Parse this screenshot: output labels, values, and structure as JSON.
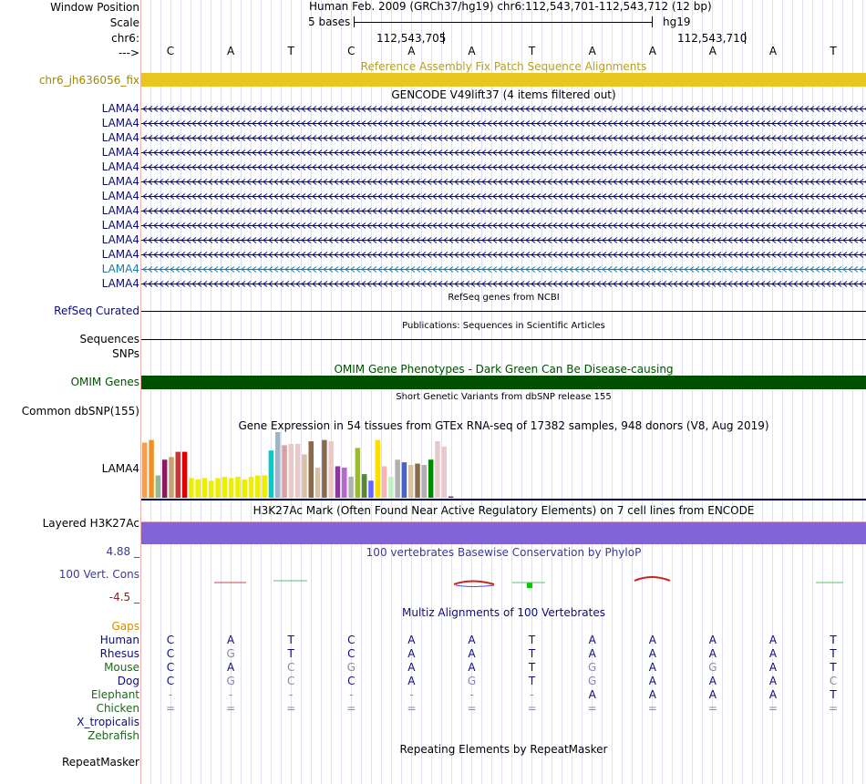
{
  "header": {
    "window_position_label": "Window Position",
    "scale_label": "Scale",
    "chr_label": "chr6:",
    "strand_label": "--->",
    "assembly_text": "Human Feb. 2009 (GRCh37/hg19)   chr6:112,543,701-112,543,712 (12 bp)",
    "scale_text": "5 bases",
    "db_text": "hg19",
    "pos1": "112,543,705",
    "pos2": "112,543,710"
  },
  "bases": [
    "C",
    "A",
    "T",
    "C",
    "A",
    "A",
    "T",
    "A",
    "A",
    "A",
    "A",
    "T"
  ],
  "fix_patch": {
    "label": "chr6_jh636056_fix",
    "title": "Reference Assembly Fix Patch Sequence Alignments",
    "color": "#e8c820"
  },
  "gencode": {
    "title": "GENCODE V49lift37 (4 items filtered out)",
    "genes": [
      "LAMA4",
      "LAMA4",
      "LAMA4",
      "LAMA4",
      "LAMA4",
      "LAMA4",
      "LAMA4",
      "LAMA4",
      "LAMA4",
      "LAMA4",
      "LAMA4",
      "LAMA4",
      "LAMA4"
    ],
    "colors": [
      "#0c0c78",
      "#0c0c78",
      "#0c0c78",
      "#0c0c78",
      "#0c0c78",
      "#0c0c78",
      "#0c0c78",
      "#0c0c78",
      "#0c0c78",
      "#0c0c78",
      "#0c0c78",
      "#1a7aa8",
      "#0c0c78"
    ]
  },
  "refseq": {
    "title": "RefSeq genes from NCBI",
    "label": "RefSeq Curated"
  },
  "publications": {
    "title": "Publications: Sequences in Scientific Articles",
    "label": "Sequences"
  },
  "snps_label": "SNPs",
  "omim": {
    "title": "OMIM Gene Phenotypes - Dark Green Can Be Disease-causing",
    "label": "OMIM Genes",
    "color": "#005000"
  },
  "dbsnp": {
    "title": "Short Genetic Variants from dbSNP release 155",
    "label": "Common dbSNP(155)"
  },
  "gtex": {
    "title": "Gene Expression in 54 tissues from GTEx RNA-seq of 17382 samples, 948 donors (V8, Aug 2019)",
    "label": "LAMA4",
    "bars": [
      {
        "v": 0.84,
        "c": "#f0a050"
      },
      {
        "v": 0.88,
        "c": "#f09020"
      },
      {
        "v": 0.34,
        "c": "#8fbc8f"
      },
      {
        "v": 0.58,
        "c": "#8b1a5a"
      },
      {
        "v": 0.62,
        "c": "#c8a070"
      },
      {
        "v": 0.7,
        "c": "#cc3333"
      },
      {
        "v": 0.7,
        "c": "#dd0000"
      },
      {
        "v": 0.3,
        "c": "#eeee00"
      },
      {
        "v": 0.28,
        "c": "#eeee00"
      },
      {
        "v": 0.3,
        "c": "#eeee00"
      },
      {
        "v": 0.26,
        "c": "#eeee00"
      },
      {
        "v": 0.3,
        "c": "#eeee00"
      },
      {
        "v": 0.32,
        "c": "#eeee00"
      },
      {
        "v": 0.3,
        "c": "#eeee00"
      },
      {
        "v": 0.32,
        "c": "#eeee00"
      },
      {
        "v": 0.28,
        "c": "#eeee00"
      },
      {
        "v": 0.32,
        "c": "#eeee00"
      },
      {
        "v": 0.34,
        "c": "#eeee00"
      },
      {
        "v": 0.34,
        "c": "#eeee00"
      },
      {
        "v": 0.72,
        "c": "#00cccc"
      },
      {
        "v": 1.0,
        "c": "#a0b4c8"
      },
      {
        "v": 0.8,
        "c": "#dba0a0"
      },
      {
        "v": 0.82,
        "c": "#e8c8c8"
      },
      {
        "v": 0.82,
        "c": "#e8c8c8"
      },
      {
        "v": 0.66,
        "c": "#d8c0a0"
      },
      {
        "v": 0.86,
        "c": "#8b6a4a"
      },
      {
        "v": 0.46,
        "c": "#d8c0a0"
      },
      {
        "v": 0.88,
        "c": "#8b6a4a"
      },
      {
        "v": 0.86,
        "c": "#e8c8c8"
      },
      {
        "v": 0.48,
        "c": "#8b3a9a"
      },
      {
        "v": 0.46,
        "c": "#bb66cc"
      },
      {
        "v": 0.32,
        "c": "#b0b0b0"
      },
      {
        "v": 0.76,
        "c": "#99bb33"
      },
      {
        "v": 0.36,
        "c": "#558b2f"
      },
      {
        "v": 0.26,
        "c": "#6666ff"
      },
      {
        "v": 0.88,
        "c": "#ffdd00"
      },
      {
        "v": 0.48,
        "c": "#ffb0b0"
      },
      {
        "v": 0.32,
        "c": "#c0f0c0"
      },
      {
        "v": 0.58,
        "c": "#b0b0b0"
      },
      {
        "v": 0.54,
        "c": "#4466cc"
      },
      {
        "v": 0.5,
        "c": "#d8c0a0"
      },
      {
        "v": 0.52,
        "c": "#8b6a4a"
      },
      {
        "v": 0.5,
        "c": "#b0b0b0"
      },
      {
        "v": 0.58,
        "c": "#008800"
      },
      {
        "v": 0.86,
        "c": "#e8c8c8"
      },
      {
        "v": 0.78,
        "c": "#e8c8c8"
      },
      {
        "v": 0.02,
        "c": "#aa00aa"
      }
    ]
  },
  "h3k27ac": {
    "title": "H3K27Ac Mark (Often Found Near Active Regulatory Elements) on 7 cell lines from ENCODE",
    "label": "Layered H3K27Ac",
    "color": "#8064d8"
  },
  "phylop": {
    "title": "100 vertebrates Basewise Conservation by PhyloP",
    "label": "100 Vert. Cons",
    "max": "4.88 _",
    "min": "-4.5 _"
  },
  "multiz": {
    "title": "Multiz Alignments of 100 Vertebrates",
    "gaps_label": "Gaps",
    "species": [
      {
        "name": "Human",
        "color": "#0c0c78",
        "seq": [
          "C",
          "A",
          "T",
          "C",
          "A",
          "A",
          "T",
          "A",
          "A",
          "A",
          "A",
          "T"
        ]
      },
      {
        "name": "Rhesus",
        "color": "#0c0c78",
        "seq": [
          "C",
          "G",
          "T",
          "C",
          "A",
          "A",
          "T",
          "A",
          "A",
          "A",
          "A",
          "T"
        ]
      },
      {
        "name": "Mouse",
        "color": "#1a6a1a",
        "seq": [
          "C",
          "A",
          "C",
          "G",
          "A",
          "A",
          "T",
          "G",
          "A",
          "G",
          "A",
          "T"
        ]
      },
      {
        "name": "Dog",
        "color": "#0c0c78",
        "seq": [
          "C",
          "G",
          "C",
          "C",
          "A",
          "G",
          "T",
          "G",
          "A",
          "A",
          "A",
          "C"
        ]
      },
      {
        "name": "Elephant",
        "color": "#1a6a1a",
        "seq": [
          "-",
          "-",
          "-",
          "-",
          "-",
          "-",
          "-",
          "A",
          "A",
          "A",
          "A",
          "T"
        ]
      },
      {
        "name": "Chicken",
        "color": "#1a6a1a",
        "seq": [
          "=",
          "=",
          "=",
          "=",
          "=",
          "=",
          "=",
          "=",
          "=",
          "=",
          "=",
          "="
        ]
      },
      {
        "name": "X_tropicalis",
        "color": "#0c0c78",
        "seq": [
          "",
          "",
          "",
          "",
          "",
          "",
          "",
          "",
          "",
          "",
          "",
          ""
        ]
      },
      {
        "name": "Zebrafish",
        "color": "#1a6a1a",
        "seq": [
          "",
          "",
          "",
          "",
          "",
          "",
          "",
          "",
          "",
          "",
          "",
          ""
        ]
      }
    ],
    "diff": [
      [
        0,
        0,
        0,
        0,
        0,
        0,
        0,
        0,
        0,
        0,
        0,
        0
      ],
      [
        0,
        1,
        0,
        0,
        0,
        0,
        0,
        0,
        0,
        0,
        0,
        0
      ],
      [
        0,
        0,
        1,
        1,
        0,
        0,
        0,
        1,
        0,
        1,
        0,
        0
      ],
      [
        0,
        1,
        1,
        0,
        0,
        1,
        0,
        1,
        0,
        0,
        0,
        1
      ],
      [
        1,
        1,
        1,
        1,
        1,
        1,
        1,
        0,
        0,
        0,
        0,
        0
      ],
      [
        1,
        1,
        1,
        1,
        1,
        1,
        1,
        1,
        1,
        1,
        1,
        1
      ],
      [
        0,
        0,
        0,
        0,
        0,
        0,
        0,
        0,
        0,
        0,
        0,
        0
      ],
      [
        0,
        0,
        0,
        0,
        0,
        0,
        0,
        0,
        0,
        0,
        0,
        0
      ]
    ]
  },
  "repeatmasker": {
    "title": "Repeating Elements by RepeatMasker",
    "label": "RepeatMasker"
  }
}
